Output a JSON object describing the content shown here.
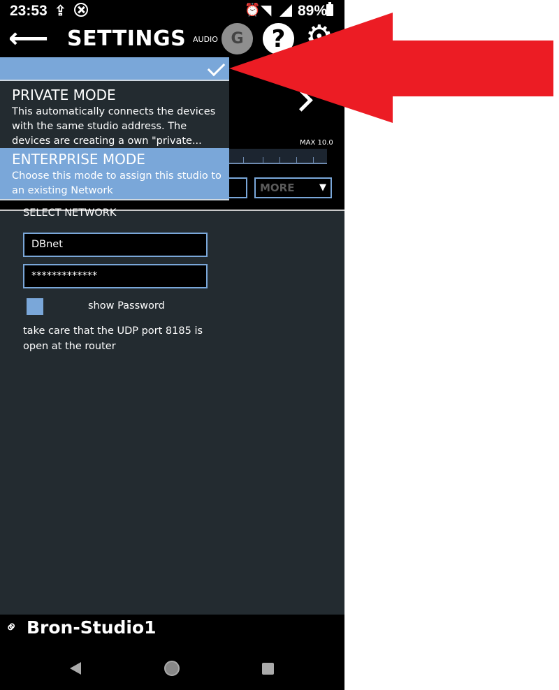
{
  "status_bar": {
    "time": "23:53",
    "battery": "89%"
  },
  "app_bar": {
    "title": "SETTINGS",
    "audio_label": "AUDIO",
    "avatar_letter": "G",
    "help_symbol": "?"
  },
  "background": {
    "max_label": "MAX 10.0",
    "more_label": "MORE"
  },
  "mode_popup": {
    "options": [
      {
        "name": "PRIVATE MODE",
        "description": "This automatically connects the devices with the same studio address. The devices are creating a own \"private...",
        "selected": false
      },
      {
        "name": "ENTERPRISE MODE",
        "description": "Choose this mode to assign this studio to an existing Network",
        "selected": true
      }
    ]
  },
  "network": {
    "select_label": "SELECT NETWORK",
    "network_value": "DBnet",
    "password_value": "*************",
    "show_password_label": "show Password",
    "note": "take care that the UDP port 8185 is open at the router"
  },
  "studio": {
    "name": "Bron-Studio1"
  },
  "colors": {
    "accent_blue": "#7aa7d9",
    "panel_dark": "#232b30",
    "annotation_red": "#ec1c24"
  }
}
